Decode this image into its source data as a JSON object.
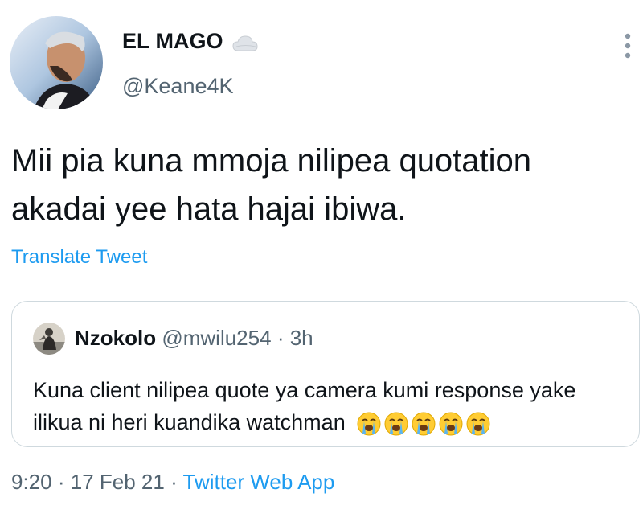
{
  "author": {
    "display_name": "EL MAGO",
    "handle": "@Keane4K",
    "badge_icon": "cloud-icon"
  },
  "tweet": {
    "text": "Mii pia kuna mmoja nilipea quotation akadai yee hata hajai ibiwa.",
    "translate_label": "Translate Tweet"
  },
  "quoted": {
    "display_name": "Nzokolo",
    "handle": "@mwilu254",
    "separator": "·",
    "time": "3h",
    "text": "Kuna client nilipea quote ya camera kumi response yake ilikua ni heri kuandika watchman",
    "emojis": [
      "loudly-crying-face",
      "loudly-crying-face",
      "loudly-crying-face",
      "loudly-crying-face",
      "loudly-crying-face"
    ]
  },
  "meta": {
    "time": "9:20",
    "separator1": "·",
    "date": "17 Feb 21",
    "separator2": "·",
    "source": "Twitter Web App"
  },
  "colors": {
    "link": "#1d9bf0",
    "secondary_text": "#536471",
    "border": "#cfd9de"
  }
}
